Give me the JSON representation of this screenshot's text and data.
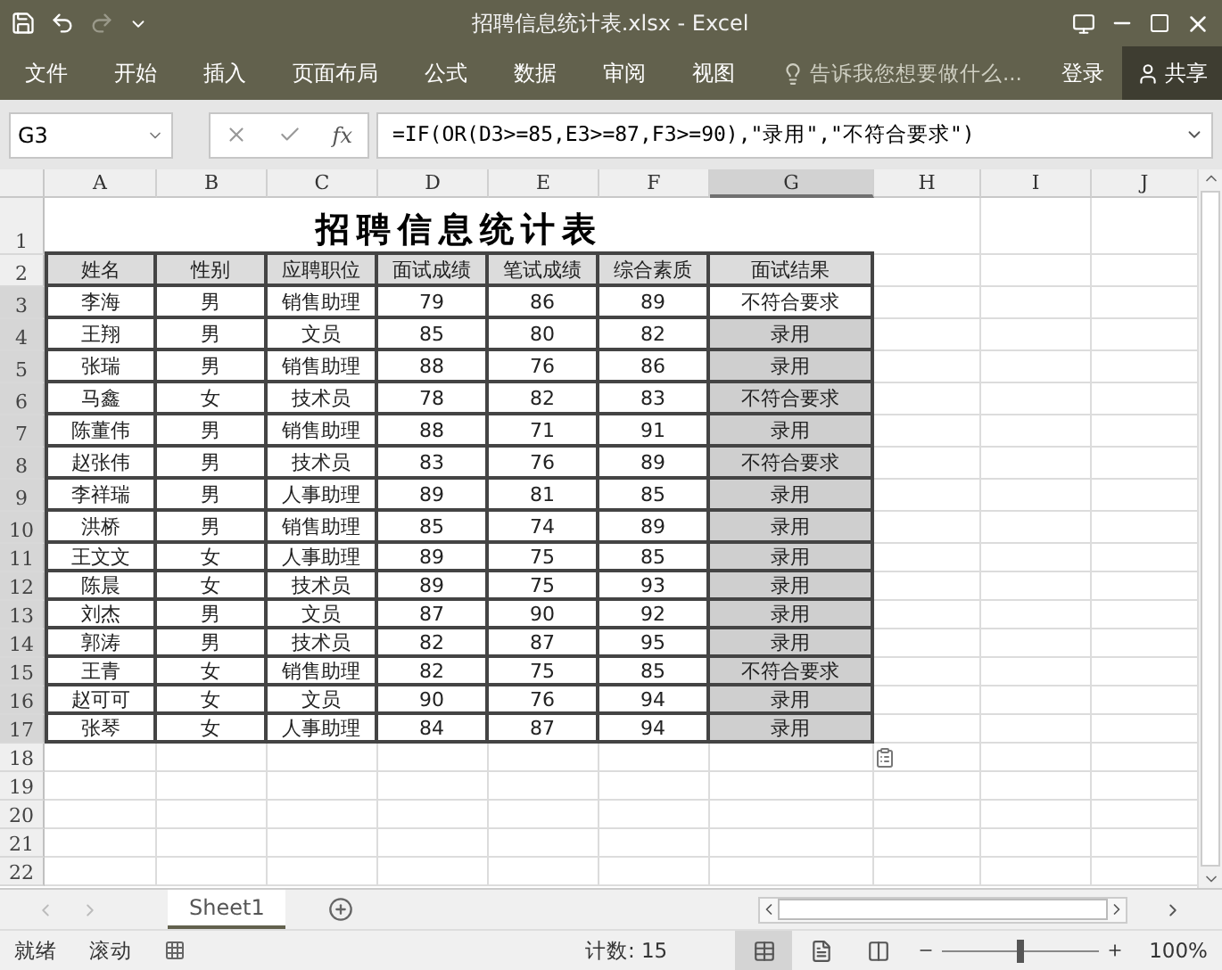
{
  "window": {
    "title": "招聘信息统计表.xlsx - Excel"
  },
  "ribbon_tabs": [
    "文件",
    "开始",
    "插入",
    "页面布局",
    "公式",
    "数据",
    "审阅",
    "视图"
  ],
  "tell_me": "告诉我您想要做什么...",
  "sign_in": "登录",
  "share": "共享",
  "name_box": "G3",
  "fx": "fx",
  "formula": "=IF(OR(D3>=85,E3>=87,F3>=90),\"录用\",\"不符合要求\")",
  "columns": [
    {
      "label": "A",
      "selected": false
    },
    {
      "label": "B",
      "selected": false
    },
    {
      "label": "C",
      "selected": false
    },
    {
      "label": "D",
      "selected": false
    },
    {
      "label": "E",
      "selected": false
    },
    {
      "label": "F",
      "selected": false
    },
    {
      "label": "G",
      "selected": true
    },
    {
      "label": "H",
      "selected": false
    },
    {
      "label": "I",
      "selected": false
    },
    {
      "label": "J",
      "selected": false
    }
  ],
  "title_row": {
    "number": "1",
    "text": "招聘信息统计表"
  },
  "header_row": {
    "number": "2",
    "cells": [
      "姓名",
      "性别",
      "应聘职位",
      "面试成绩",
      "笔试成绩",
      "综合素质",
      "面试结果"
    ]
  },
  "rows": [
    {
      "number": "3",
      "selected": true,
      "active": true,
      "cells": [
        "李海",
        "男",
        "销售助理",
        "79",
        "86",
        "89",
        "不符合要求"
      ]
    },
    {
      "number": "4",
      "selected": true,
      "active": false,
      "cells": [
        "王翔",
        "男",
        "文员",
        "85",
        "80",
        "82",
        "录用"
      ]
    },
    {
      "number": "5",
      "selected": true,
      "active": false,
      "cells": [
        "张瑞",
        "男",
        "销售助理",
        "88",
        "76",
        "86",
        "录用"
      ]
    },
    {
      "number": "6",
      "selected": true,
      "active": false,
      "cells": [
        "马鑫",
        "女",
        "技术员",
        "78",
        "82",
        "83",
        "不符合要求"
      ]
    },
    {
      "number": "7",
      "selected": true,
      "active": false,
      "cells": [
        "陈董伟",
        "男",
        "销售助理",
        "88",
        "71",
        "91",
        "录用"
      ]
    },
    {
      "number": "8",
      "selected": true,
      "active": false,
      "cells": [
        "赵张伟",
        "男",
        "技术员",
        "83",
        "76",
        "89",
        "不符合要求"
      ]
    },
    {
      "number": "9",
      "selected": true,
      "active": false,
      "cells": [
        "李祥瑞",
        "男",
        "人事助理",
        "89",
        "81",
        "85",
        "录用"
      ]
    },
    {
      "number": "10",
      "selected": true,
      "active": false,
      "cells": [
        "洪桥",
        "男",
        "销售助理",
        "85",
        "74",
        "89",
        "录用"
      ]
    },
    {
      "number": "11",
      "selected": true,
      "active": false,
      "cells": [
        "王文文",
        "女",
        "人事助理",
        "89",
        "75",
        "85",
        "录用"
      ]
    },
    {
      "number": "12",
      "selected": true,
      "active": false,
      "cells": [
        "陈晨",
        "女",
        "技术员",
        "89",
        "75",
        "93",
        "录用"
      ]
    },
    {
      "number": "13",
      "selected": true,
      "active": false,
      "cells": [
        "刘杰",
        "男",
        "文员",
        "87",
        "90",
        "92",
        "录用"
      ]
    },
    {
      "number": "14",
      "selected": true,
      "active": false,
      "cells": [
        "郭涛",
        "男",
        "技术员",
        "82",
        "87",
        "95",
        "录用"
      ]
    },
    {
      "number": "15",
      "selected": true,
      "active": false,
      "cells": [
        "王青",
        "女",
        "销售助理",
        "82",
        "75",
        "85",
        "不符合要求"
      ]
    },
    {
      "number": "16",
      "selected": true,
      "active": false,
      "cells": [
        "赵可可",
        "女",
        "文员",
        "90",
        "76",
        "94",
        "录用"
      ]
    },
    {
      "number": "17",
      "selected": true,
      "active": false,
      "cells": [
        "张琴",
        "女",
        "人事助理",
        "84",
        "87",
        "94",
        "录用"
      ]
    }
  ],
  "empty_rows": [
    "18",
    "19",
    "20",
    "21",
    "22"
  ],
  "sheet_tabs": [
    {
      "label": "Sheet1",
      "selected": true
    }
  ],
  "status": {
    "mode": "就绪",
    "scroll": "滚动",
    "count": "计数: 15",
    "zoom": "100%"
  },
  "views": [
    {
      "kind": "normal",
      "selected": true
    },
    {
      "kind": "layout",
      "selected": false
    },
    {
      "kind": "break",
      "selected": false
    }
  ],
  "zoom_slider": {
    "level": 0.5
  }
}
